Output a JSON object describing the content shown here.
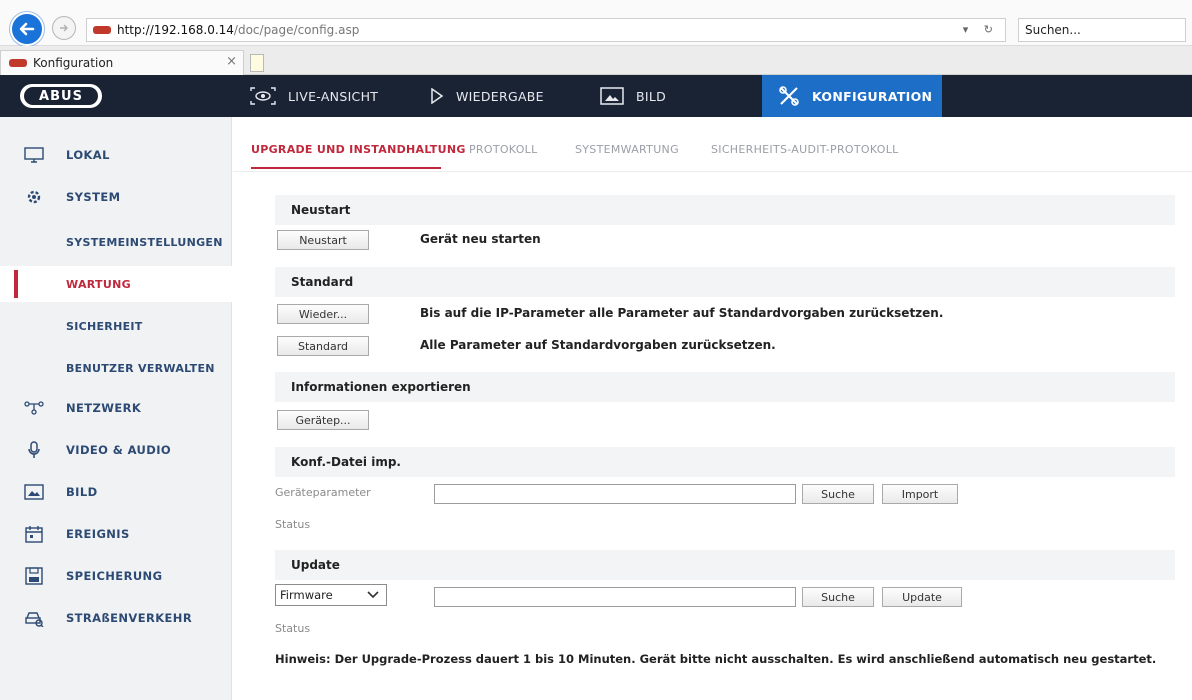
{
  "browser": {
    "url_host": "http://192.168.0.14",
    "url_path": "/doc/page/config.asp",
    "search_placeholder": "Suchen...",
    "tab_title": "Konfiguration",
    "tab_close": "×"
  },
  "header": {
    "logo": "ABUS",
    "nav": {
      "live": "LIVE-ANSICHT",
      "playback": "WIEDERGABE",
      "image": "BILD",
      "config": "KONFIGURATION"
    }
  },
  "sidebar": {
    "items": {
      "local": "LOKAL",
      "system": "SYSTEM",
      "system_settings": "SYSTEMEINSTELLUNGEN",
      "maintenance": "WARTUNG",
      "security": "SICHERHEIT",
      "user_management": "BENUTZER VERWALTEN",
      "network": "NETZWERK",
      "video_audio": "VIDEO & AUDIO",
      "image": "BILD",
      "event": "EREIGNIS",
      "storage": "SPEICHERUNG",
      "traffic": "STRAßENVERKEHR"
    }
  },
  "main": {
    "tabs": {
      "upgrade": "UPGRADE UND INSTANDHALTUNG",
      "log": "PROTOKOLL",
      "system_maintenance": "SYSTEMWARTUNG",
      "security_audit": "SICHERHEITS-AUDIT-PROTOKOLL"
    },
    "reboot": {
      "title": "Neustart",
      "button": "Neustart",
      "description": "Gerät neu starten"
    },
    "defaults": {
      "title": "Standard",
      "restore_button": "Wieder...",
      "restore_description": "Bis auf die IP-Parameter alle Parameter auf Standardvorgaben zurücksetzen.",
      "default_button": "Standard",
      "default_description": "Alle Parameter auf Standardvorgaben zurücksetzen."
    },
    "export": {
      "title": "Informationen exportieren",
      "button": "Gerätep..."
    },
    "import_config": {
      "title": "Konf.-Datei imp.",
      "param_label": "Geräteparameter",
      "browse_button": "Suche",
      "import_button": "Import",
      "status_label": "Status"
    },
    "update": {
      "title": "Update",
      "select_value": "Firmware",
      "browse_button": "Suche",
      "update_button": "Update",
      "status_label": "Status"
    },
    "note": "Hinweis: Der Upgrade-Prozess dauert 1 bis 10 Minuten. Gerät bitte nicht ausschalten. Es wird anschließend automatisch neu gestartet."
  }
}
